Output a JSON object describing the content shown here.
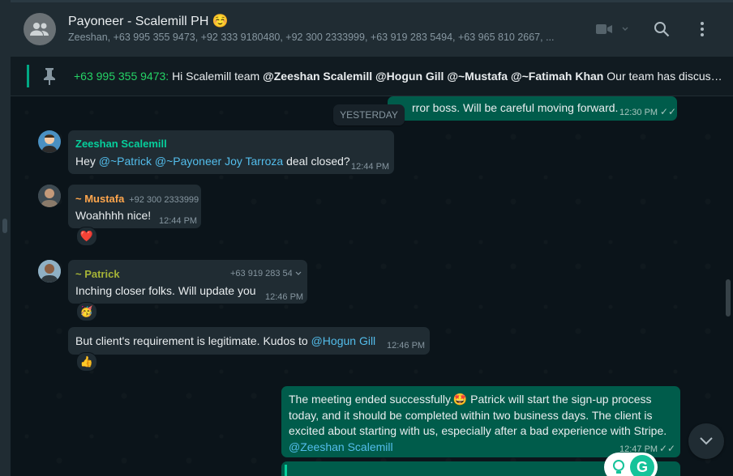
{
  "chat": {
    "title": "Payoneer - Scalemill PH ☺️",
    "subtitle": "Zeeshan, +63 995 355 9473, +92 333 9180480, +92 300 2333999, +63 919 283 5494, +63 965 810 2667, ...",
    "icons": {
      "group_avatar": "group-icon",
      "video": "video-call-icon",
      "dropdown": "chevron-down-icon",
      "search": "search-icon",
      "menu": "menu-dots-icon"
    }
  },
  "pinned": {
    "icon": "pin-icon",
    "sender": "+63 995 355 9473:",
    "text_prefix": "Hi Scalemill team",
    "mentions": [
      "@Zeeshan Scalemill",
      "@Hogun Gill",
      "@~Mustafa",
      "@~Fatimah Khan"
    ],
    "text_suffix": "Our team has discusse..."
  },
  "date_separator": "YESTERDAY",
  "messages": {
    "top_partial": {
      "text": "rror boss. Will be careful moving forward.",
      "time": "12:30 PM"
    },
    "m1": {
      "sender": "Zeeshan Scalemill",
      "text_before": "Hey ",
      "mention1": "@~Patrick",
      "mention2": "@~Payoneer Joy Tarroza",
      "text_after": " deal closed?",
      "time": "12:44 PM"
    },
    "m2": {
      "sender": "~ Mustafa",
      "phone": "+92 300 2333999",
      "text": "Woahhhh nice!",
      "time": "12:44 PM",
      "reaction": "❤️"
    },
    "m3": {
      "sender": "~ Patrick",
      "phone": "+63 919 283 5494",
      "text": "Inching closer folks. Will update you",
      "time": "12:46 PM",
      "reaction": "🥳"
    },
    "m4": {
      "text_before": "But client's requirement is legitimate. Kudos to ",
      "mention": "@Hogun Gill",
      "time": "12:46 PM",
      "reaction": "👍"
    },
    "m5": {
      "text_before": "The meeting ended successfully.",
      "emoji": "🤩",
      "text_after": " Patrick will start the sign-up process today, and it should be completed within two business days. The client is excited about starting with us, especially after a bad experience with Stripe.",
      "mention": "@Zeeshan Scalemill",
      "time": "12:47 PM"
    }
  },
  "colors": {
    "accent": "#00a884",
    "outgoing": "#005c4b",
    "incoming": "#202c33",
    "mention": "#53bdeb",
    "name_zeeshan": "#06cf9c",
    "name_mustafa": "#ffa64d",
    "name_patrick": "#a5b337"
  },
  "scroll_down_icon": "chevron-down-icon"
}
